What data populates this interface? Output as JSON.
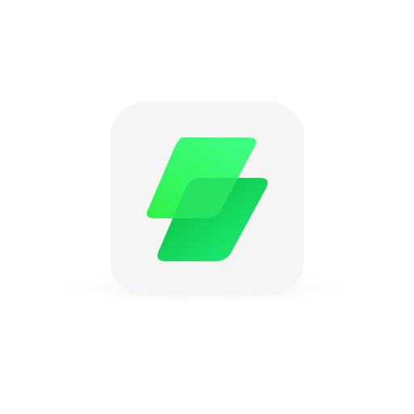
{
  "app_icon": {
    "icon": "layered-green-parallelograms-icon",
    "background_color": "#f5f5f5",
    "colors": {
      "top_layer_start": "#2ff24a",
      "top_layer_end": "#3dff86",
      "bottom_layer_start": "#07b93a",
      "bottom_layer_end": "#1ef27c",
      "overlap": "#26e061"
    }
  }
}
